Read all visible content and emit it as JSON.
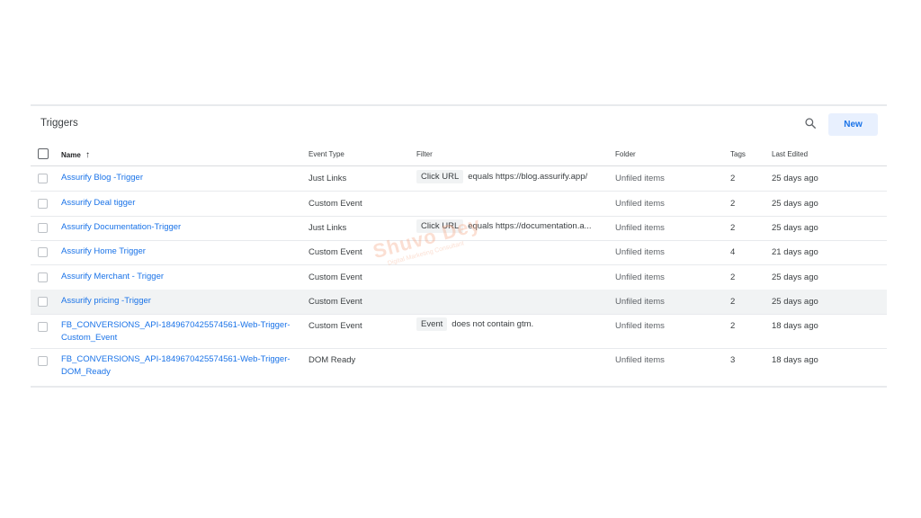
{
  "panel": {
    "title": "Triggers",
    "new_label": "New"
  },
  "columns": {
    "name": "Name",
    "sort_arrow": "↑",
    "event_type": "Event Type",
    "filter": "Filter",
    "folder": "Folder",
    "tags": "Tags",
    "last_edited": "Last Edited"
  },
  "rows": [
    {
      "name": "Assurify Blog -Trigger",
      "event_type": "Just Links",
      "filter_chip": "Click URL",
      "filter_text": "equals https://blog.assurify.app/",
      "folder": "Unfiled items",
      "tags": "2",
      "last_edited": "25 days ago"
    },
    {
      "name": "Assurify Deal tigger",
      "event_type": "Custom Event",
      "filter_chip": "",
      "filter_text": "",
      "folder": "Unfiled items",
      "tags": "2",
      "last_edited": "25 days ago"
    },
    {
      "name": "Assurify Documentation-Trigger",
      "event_type": "Just Links",
      "filter_chip": "Click URL",
      "filter_text": "equals https://documentation.a...",
      "folder": "Unfiled items",
      "tags": "2",
      "last_edited": "25 days ago"
    },
    {
      "name": "Assurify Home Trigger",
      "event_type": "Custom Event",
      "filter_chip": "",
      "filter_text": "",
      "folder": "Unfiled items",
      "tags": "4",
      "last_edited": "21 days ago"
    },
    {
      "name": "Assurify Merchant - Trigger",
      "event_type": "Custom Event",
      "filter_chip": "",
      "filter_text": "",
      "folder": "Unfiled items",
      "tags": "2",
      "last_edited": "25 days ago"
    },
    {
      "name": "Assurify pricing -Trigger",
      "event_type": "Custom Event",
      "filter_chip": "",
      "filter_text": "",
      "folder": "Unfiled items",
      "tags": "2",
      "last_edited": "25 days ago"
    },
    {
      "name": "FB_CONVERSIONS_API-1849670425574561-Web-Trigger-Custom_Event",
      "event_type": "Custom Event",
      "filter_chip": "Event",
      "filter_text": "does not contain gtm.",
      "folder": "Unfiled items",
      "tags": "2",
      "last_edited": "18 days ago"
    },
    {
      "name": "FB_CONVERSIONS_API-1849670425574561-Web-Trigger-DOM_Ready",
      "event_type": "DOM Ready",
      "filter_chip": "",
      "filter_text": "",
      "folder": "Unfiled items",
      "tags": "3",
      "last_edited": "18 days ago"
    }
  ],
  "watermark": {
    "main": "Shuvo Dey",
    "sub": "Digital Marketing Consultant"
  },
  "colors": {
    "link": "#1a73e8",
    "new_button_bg": "#e8f0fe",
    "highlight_row": "#f1f3f4",
    "watermark": "#f4a582"
  }
}
